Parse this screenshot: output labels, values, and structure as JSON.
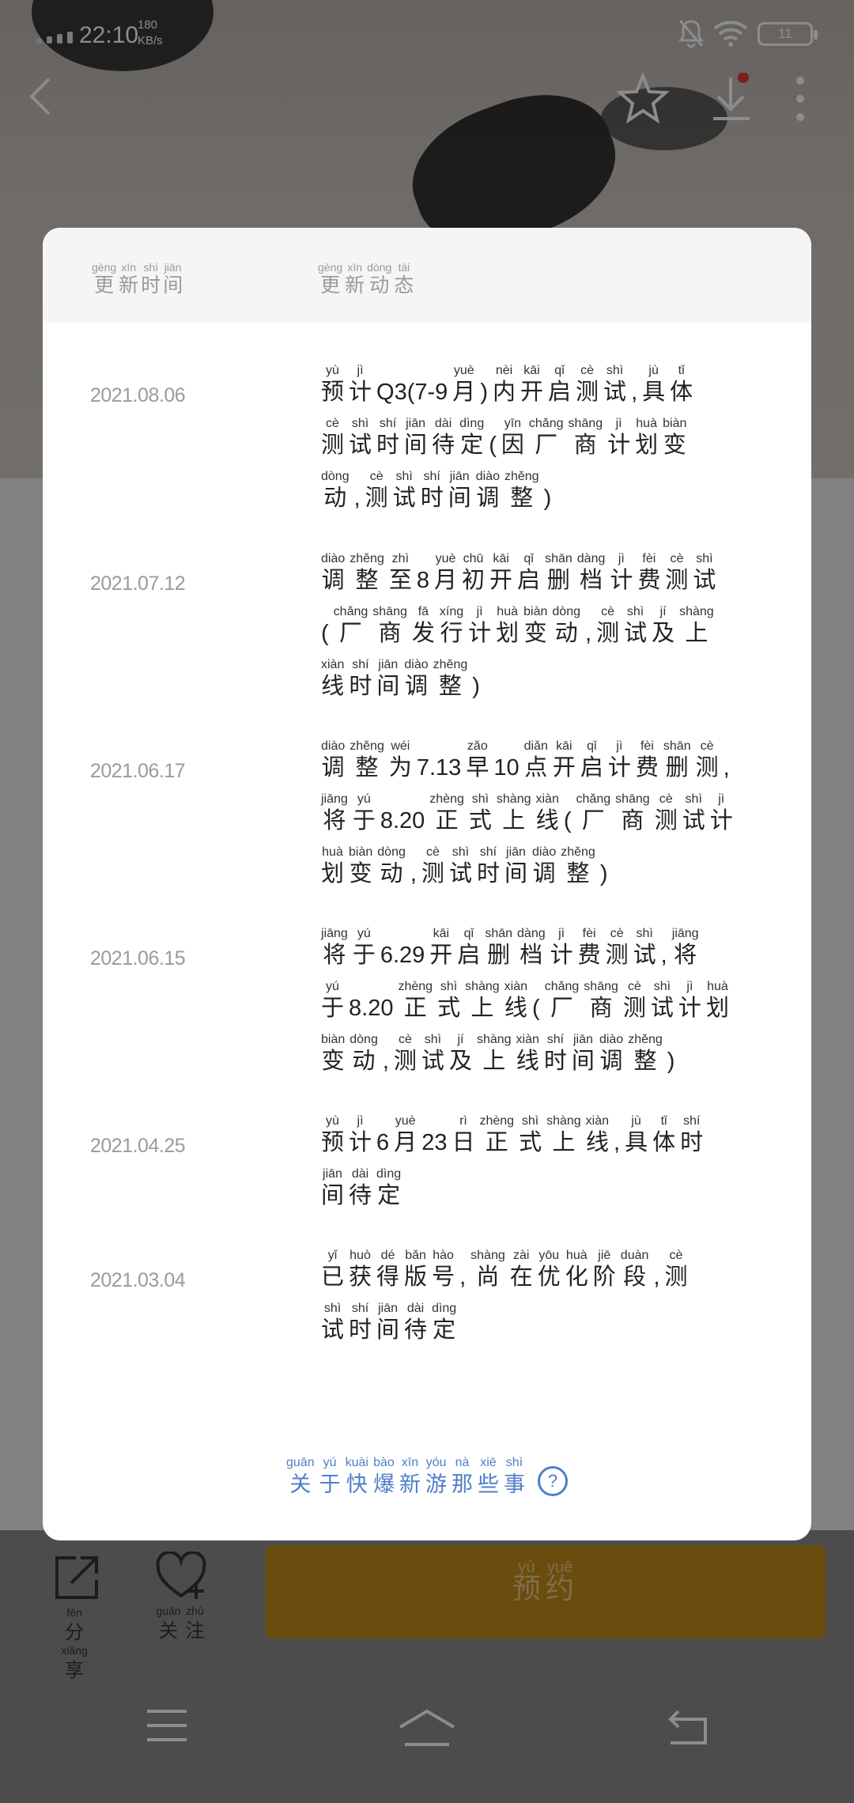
{
  "status_bar": {
    "time": "22:10",
    "speed_value": "180",
    "speed_unit": "KB/s",
    "battery": "11"
  },
  "modal": {
    "header": {
      "col_time": [
        [
          "gèng",
          "更"
        ],
        [
          "xīn",
          "新"
        ],
        [
          "shí",
          "时"
        ],
        [
          "jiān",
          "间"
        ]
      ],
      "col_news": [
        [
          "gèng",
          "更"
        ],
        [
          "xīn",
          "新"
        ],
        [
          "dòng",
          "动"
        ],
        [
          "tài",
          "态"
        ]
      ]
    },
    "rows": [
      {
        "date": "2021.08.06",
        "lines": [
          [
            [
              "yù",
              "预"
            ],
            [
              "jì",
              "计"
            ],
            [
              "",
              "Q3(7-9"
            ],
            [
              "yuè",
              "月"
            ],
            [
              "",
              ")"
            ],
            [
              "nèi",
              "内"
            ],
            [
              "kāi",
              "开"
            ],
            [
              "qǐ",
              "启"
            ],
            [
              "cè",
              "测"
            ],
            [
              "shì",
              "试"
            ],
            [
              "",
              ","
            ],
            [
              "jù",
              "具"
            ],
            [
              "tǐ",
              "体"
            ]
          ],
          [
            [
              "cè",
              "测"
            ],
            [
              "shì",
              "试"
            ],
            [
              "shí",
              "时"
            ],
            [
              "jiān",
              "间"
            ],
            [
              "dài",
              "待"
            ],
            [
              "dìng",
              "定"
            ],
            [
              "",
              "("
            ],
            [
              "yīn",
              "因"
            ],
            [
              "chǎng",
              "厂"
            ],
            [
              "shāng",
              "商"
            ],
            [
              "jì",
              "计"
            ],
            [
              "huà",
              "划"
            ],
            [
              "biàn",
              "变"
            ]
          ],
          [
            [
              "dòng",
              "动"
            ],
            [
              "",
              ","
            ],
            [
              "cè",
              "测"
            ],
            [
              "shì",
              "试"
            ],
            [
              "shí",
              "时"
            ],
            [
              "jiān",
              "间"
            ],
            [
              "diào",
              "调"
            ],
            [
              "zhěng",
              "整"
            ],
            [
              "",
              ")"
            ]
          ]
        ]
      },
      {
        "date": "2021.07.12",
        "lines": [
          [
            [
              "diào",
              "调"
            ],
            [
              "zhěng",
              "整"
            ],
            [
              "zhì",
              "至"
            ],
            [
              "",
              "8"
            ],
            [
              "yuè",
              "月"
            ],
            [
              "chū",
              "初"
            ],
            [
              "kāi",
              "开"
            ],
            [
              "qǐ",
              "启"
            ],
            [
              "shān",
              "删"
            ],
            [
              "dàng",
              "档"
            ],
            [
              "jì",
              "计"
            ],
            [
              "fèi",
              "费"
            ],
            [
              "cè",
              "测"
            ],
            [
              "shì",
              "试"
            ]
          ],
          [
            [
              "",
              "("
            ],
            [
              "chǎng",
              "厂"
            ],
            [
              "shāng",
              "商"
            ],
            [
              "fā",
              "发"
            ],
            [
              "xíng",
              "行"
            ],
            [
              "jì",
              "计"
            ],
            [
              "huà",
              "划"
            ],
            [
              "biàn",
              "变"
            ],
            [
              "dòng",
              "动"
            ],
            [
              "",
              ","
            ],
            [
              "cè",
              "测"
            ],
            [
              "shì",
              "试"
            ],
            [
              "jí",
              "及"
            ],
            [
              "shàng",
              "上"
            ]
          ],
          [
            [
              "xiàn",
              "线"
            ],
            [
              "shí",
              "时"
            ],
            [
              "jiān",
              "间"
            ],
            [
              "diào",
              "调"
            ],
            [
              "zhěng",
              "整"
            ],
            [
              "",
              ")"
            ]
          ]
        ]
      },
      {
        "date": "2021.06.17",
        "lines": [
          [
            [
              "diào",
              "调"
            ],
            [
              "zhěng",
              "整"
            ],
            [
              "wéi",
              "为"
            ],
            [
              "",
              "7.13"
            ],
            [
              "zǎo",
              "早"
            ],
            [
              "",
              "10"
            ],
            [
              "diǎn",
              "点"
            ],
            [
              "kāi",
              "开"
            ],
            [
              "qǐ",
              "启"
            ],
            [
              "jì",
              "计"
            ],
            [
              "fèi",
              "费"
            ],
            [
              "shān",
              "删"
            ],
            [
              "cè",
              "测"
            ],
            [
              "",
              ","
            ]
          ],
          [
            [
              "jiāng",
              "将"
            ],
            [
              "yú",
              "于"
            ],
            [
              "",
              "8.20"
            ],
            [
              "zhèng",
              "正"
            ],
            [
              "shì",
              "式"
            ],
            [
              "shàng",
              "上"
            ],
            [
              "xiàn",
              "线"
            ],
            [
              "",
              "("
            ],
            [
              "chǎng",
              "厂"
            ],
            [
              "shāng",
              "商"
            ],
            [
              "cè",
              "测"
            ],
            [
              "shì",
              "试"
            ],
            [
              "jì",
              "计"
            ]
          ],
          [
            [
              "huà",
              "划"
            ],
            [
              "biàn",
              "变"
            ],
            [
              "dòng",
              "动"
            ],
            [
              "",
              ","
            ],
            [
              "cè",
              "测"
            ],
            [
              "shì",
              "试"
            ],
            [
              "shí",
              "时"
            ],
            [
              "jiān",
              "间"
            ],
            [
              "diào",
              "调"
            ],
            [
              "zhěng",
              "整"
            ],
            [
              "",
              ")"
            ]
          ]
        ]
      },
      {
        "date": "2021.06.15",
        "lines": [
          [
            [
              "jiāng",
              "将"
            ],
            [
              "yú",
              "于"
            ],
            [
              "",
              "6.29"
            ],
            [
              "kāi",
              "开"
            ],
            [
              "qǐ",
              "启"
            ],
            [
              "shān",
              "删"
            ],
            [
              "dàng",
              "档"
            ],
            [
              "jì",
              "计"
            ],
            [
              "fèi",
              "费"
            ],
            [
              "cè",
              "测"
            ],
            [
              "shì",
              "试"
            ],
            [
              "",
              ","
            ],
            [
              "jiāng",
              "将"
            ]
          ],
          [
            [
              "yú",
              "于"
            ],
            [
              "",
              "8.20"
            ],
            [
              "zhèng",
              "正"
            ],
            [
              "shì",
              "式"
            ],
            [
              "shàng",
              "上"
            ],
            [
              "xiàn",
              "线"
            ],
            [
              "",
              "("
            ],
            [
              "chǎng",
              "厂"
            ],
            [
              "shāng",
              "商"
            ],
            [
              "cè",
              "测"
            ],
            [
              "shì",
              "试"
            ],
            [
              "jì",
              "计"
            ],
            [
              "huà",
              "划"
            ]
          ],
          [
            [
              "biàn",
              "变"
            ],
            [
              "dòng",
              "动"
            ],
            [
              "",
              ","
            ],
            [
              "cè",
              "测"
            ],
            [
              "shì",
              "试"
            ],
            [
              "jí",
              "及"
            ],
            [
              "shàng",
              "上"
            ],
            [
              "xiàn",
              "线"
            ],
            [
              "shí",
              "时"
            ],
            [
              "jiān",
              "间"
            ],
            [
              "diào",
              "调"
            ],
            [
              "zhěng",
              "整"
            ],
            [
              "",
              ")"
            ]
          ]
        ]
      },
      {
        "date": "2021.04.25",
        "lines": [
          [
            [
              "yù",
              "预"
            ],
            [
              "jì",
              "计"
            ],
            [
              "",
              "6"
            ],
            [
              "yuè",
              "月"
            ],
            [
              "",
              "23"
            ],
            [
              "rì",
              "日"
            ],
            [
              "zhèng",
              "正"
            ],
            [
              "shì",
              "式"
            ],
            [
              "shàng",
              "上"
            ],
            [
              "xiàn",
              "线"
            ],
            [
              "",
              ","
            ],
            [
              "jù",
              "具"
            ],
            [
              "tǐ",
              "体"
            ],
            [
              "shí",
              "时"
            ]
          ],
          [
            [
              "jiān",
              "间"
            ],
            [
              "dài",
              "待"
            ],
            [
              "dìng",
              "定"
            ]
          ]
        ]
      },
      {
        "date": "2021.03.04",
        "lines": [
          [
            [
              "yǐ",
              "已"
            ],
            [
              "huò",
              "获"
            ],
            [
              "dé",
              "得"
            ],
            [
              "bǎn",
              "版"
            ],
            [
              "hào",
              "号"
            ],
            [
              "",
              ","
            ],
            [
              "shàng",
              "尚"
            ],
            [
              "zài",
              "在"
            ],
            [
              "yōu",
              "优"
            ],
            [
              "huà",
              "化"
            ],
            [
              "jiē",
              "阶"
            ],
            [
              "duàn",
              "段"
            ],
            [
              "",
              ","
            ],
            [
              "cè",
              "测"
            ]
          ],
          [
            [
              "shì",
              "试"
            ],
            [
              "shí",
              "时"
            ],
            [
              "jiān",
              "间"
            ],
            [
              "dài",
              "待"
            ],
            [
              "dìng",
              "定"
            ]
          ]
        ]
      }
    ],
    "about_link": [
      [
        "guān",
        "关"
      ],
      [
        "yú",
        "于"
      ],
      [
        "kuài",
        "快"
      ],
      [
        "bào",
        "爆"
      ],
      [
        "xīn",
        "新"
      ],
      [
        "yóu",
        "游"
      ],
      [
        "nà",
        "那"
      ],
      [
        "xiē",
        "些"
      ],
      [
        "shì",
        "事"
      ]
    ],
    "about_icon": "?"
  },
  "bottom_bar": {
    "share": [
      [
        "fēn",
        "分"
      ],
      [
        "xiǎng",
        "享"
      ]
    ],
    "follow": [
      [
        "guān",
        "关"
      ],
      [
        "zhù",
        "注"
      ]
    ],
    "reserve": [
      [
        "yù",
        "预"
      ],
      [
        "yuē",
        "约"
      ]
    ]
  },
  "colors": {
    "link_blue": "#4f7fc8",
    "reserve_orange": "#c28a1a",
    "date_gray": "#9b9b9b"
  }
}
